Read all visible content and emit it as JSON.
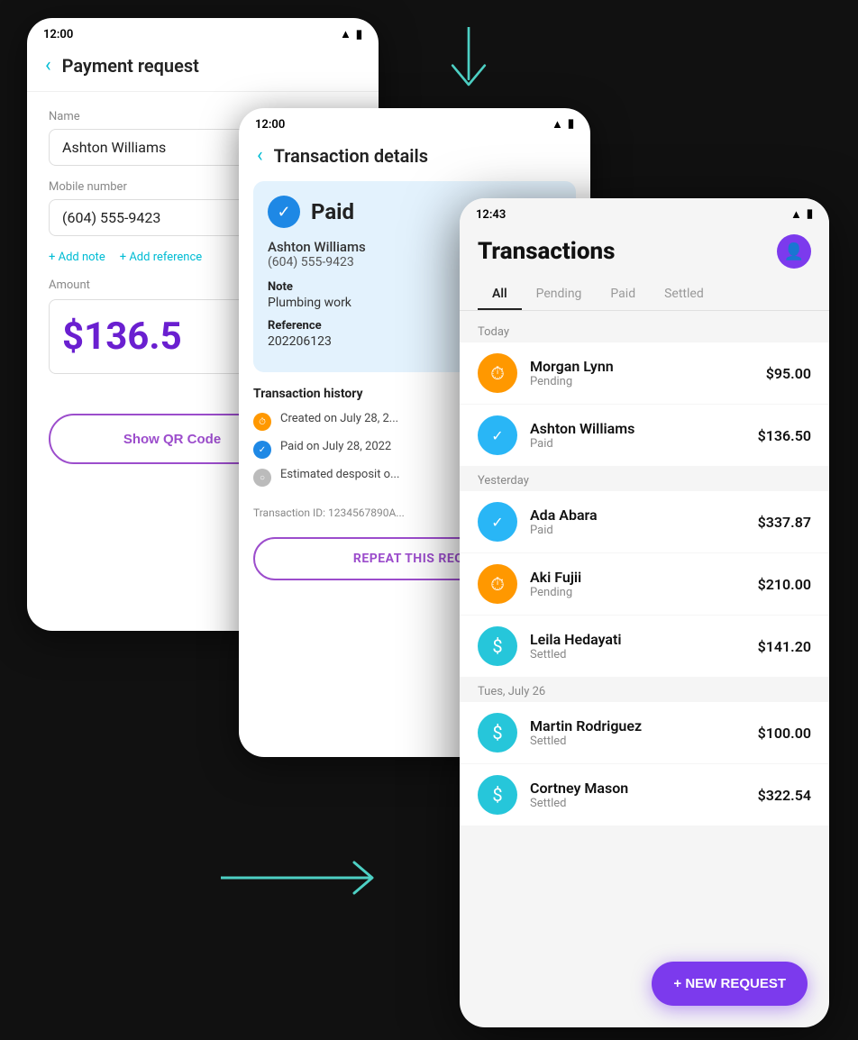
{
  "arrows": {
    "down_color": "#4dd0c4",
    "right_color": "#4dd0c4"
  },
  "screen_payment": {
    "status_bar": {
      "time": "12:00"
    },
    "header": {
      "back_label": "‹",
      "title": "Payment request"
    },
    "name_label": "Name",
    "name_value": "Ashton Williams",
    "mobile_label": "Mobile number",
    "mobile_value": "(604) 555-9423",
    "add_note": "+ Add note",
    "add_reference": "+ Add reference",
    "amount_label": "Amount",
    "amount_value": "$136.5",
    "show_qr_label": "Show QR Code"
  },
  "screen_details": {
    "status_bar": {
      "time": "12:00"
    },
    "header": {
      "back_label": "‹",
      "title": "Transaction details"
    },
    "paid_label": "Paid",
    "contact_name": "Ashton Williams",
    "contact_phone": "(604) 555-9423",
    "note_label": "Note",
    "note_value": "Plumbing work",
    "reference_label": "Reference",
    "reference_value": "202206123",
    "history_title": "Transaction history",
    "history_items": [
      {
        "type": "orange",
        "text": "Created on July 28, 2..."
      },
      {
        "type": "blue",
        "text": "Paid on July 28, 2022"
      },
      {
        "type": "gray",
        "text": "Estimated desposit o..."
      }
    ],
    "transaction_id": "Transaction ID: 1234567890A...",
    "repeat_label": "REPEAT THIS REQ..."
  },
  "screen_list": {
    "status_bar": {
      "time": "12:43"
    },
    "header": {
      "title": "Transactions"
    },
    "tabs": [
      {
        "label": "All",
        "active": true
      },
      {
        "label": "Pending",
        "active": false
      },
      {
        "label": "Paid",
        "active": false
      },
      {
        "label": "Settled",
        "active": false
      }
    ],
    "sections": [
      {
        "label": "Today",
        "items": [
          {
            "name": "Morgan Lynn",
            "status": "Pending",
            "amount": "$95.00",
            "icon_type": "orange",
            "icon": "⏱"
          },
          {
            "name": "Ashton Williams",
            "status": "Paid",
            "amount": "$136.50",
            "icon_type": "blue",
            "icon": "✓"
          }
        ]
      },
      {
        "label": "Yesterday",
        "items": [
          {
            "name": "Ada Abara",
            "status": "Paid",
            "amount": "$337.87",
            "icon_type": "blue",
            "icon": "✓"
          },
          {
            "name": "Aki Fujii",
            "status": "Pending",
            "amount": "$210.00",
            "icon_type": "orange",
            "icon": "⏱"
          },
          {
            "name": "Leila Hedayati",
            "status": "Settled",
            "amount": "$141.20",
            "icon_type": "teal",
            "icon": "$"
          }
        ]
      },
      {
        "label": "Tues, July 26",
        "items": [
          {
            "name": "Martin Rodriguez",
            "status": "Settled",
            "amount": "$100.00",
            "icon_type": "teal",
            "icon": "$"
          },
          {
            "name": "Cortney Mason",
            "status": "Settled",
            "amount": "$322.54",
            "icon_type": "teal",
            "icon": "$"
          }
        ]
      }
    ],
    "new_request_label": "+ NEW REQUEST"
  }
}
